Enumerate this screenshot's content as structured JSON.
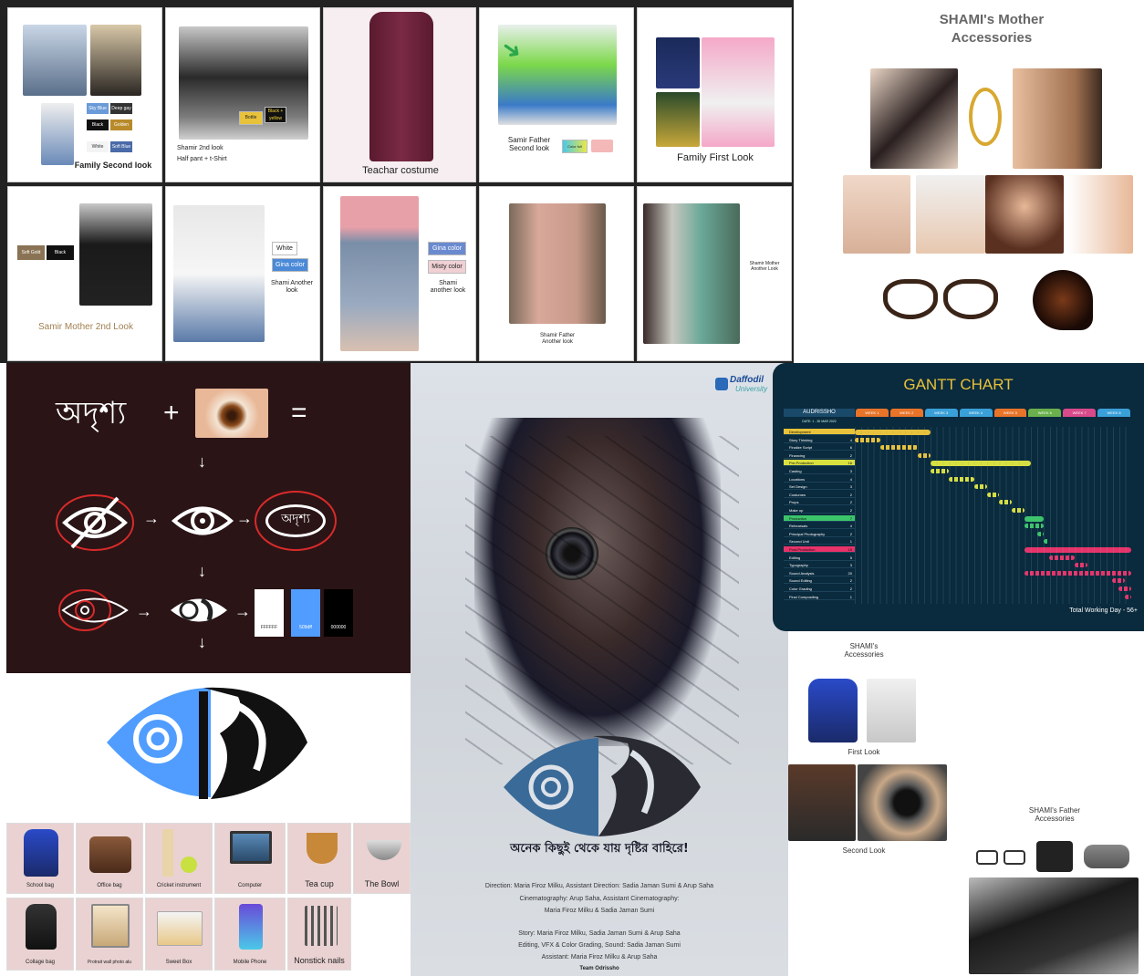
{
  "collage": {
    "costumes": {
      "family_second_look": "Family Second look",
      "swatches_fsl": [
        "Sky Blue",
        "Deep gay",
        "Black",
        "Golden",
        "White",
        "Soft Blue"
      ],
      "shamir_2nd_look": "Shamir 2nd look",
      "half_pant": "Half pant + t-Shirt",
      "tag_bottle": "Bottle",
      "tag_black_yellow": "Black + yellow",
      "teacher_costume": "Teachar costume",
      "samir_father_second_look": "Samir Father\nSecond look",
      "color_full": "Color full",
      "family_first_look": "Family First Look",
      "soft_gold": "Soft Gold",
      "black": "Black",
      "samir_mother_2nd_look": "Samir Mother 2nd Look",
      "white": "White",
      "gina_color": "Gina color",
      "shami_another_look": "Shami Another\nlook",
      "gina_color_2": "Gina color",
      "misty_color": "Misty color",
      "shami_another_look_2": "Shami\nanother look",
      "shamir_father_another_look": "Shamir Father\nAnother look",
      "shamir_mother_another_look": "Shamir Mother\nAnother Look"
    },
    "mother_accessories": {
      "title": "SHAMI's Mother\nAccessories"
    },
    "logo_board": {
      "bangla_word": "অদৃশ্য",
      "plus": "+",
      "equals": "=",
      "arrow_down": "↓",
      "arrow_right": "→",
      "eye_word": "অদৃশ্য",
      "colors": [
        {
          "hex": "#ffffff",
          "label": "FFFFFF"
        },
        {
          "hex": "#509dff",
          "label": "509dff"
        },
        {
          "hex": "#000000",
          "label": "000000"
        }
      ]
    },
    "poster": {
      "university": "Daffodil",
      "university_sub": "University",
      "tagline": "অনেক কিছুই থেকে যায় দৃষ্টির বাহিরে!",
      "credits": [
        "Direction: Maria Firoz Milku, Assistant Direction: Sadia Jaman Sumi & Arup Saha",
        "Cinematography: Arup Saha, Assistant Cinematography:",
        "Maria Firoz Milku & Sadia Jaman Sumi",
        "Story: Maria Firoz Milku, Sadia Jaman Sumi & Arup Saha",
        "Editing, VFX & Color Grading, Sound: Sadia Jaman Sumi",
        "Assistant: Maria Firoz Milku & Arup Saha",
        "Team Odrissho"
      ]
    },
    "gantt": {
      "title": "GANTT CHART",
      "header": "AUDRISSHO",
      "date_range": "DATE: 1 - 30 MAR 2022",
      "weeks": [
        "WEEK 1",
        "WEEK 2",
        "WEEK 3",
        "WEEK 4",
        "WEEK 5",
        "WEEK 6",
        "WEEK 7",
        "WEEK 8"
      ],
      "week_colors": [
        "#e8742a",
        "#e8742a",
        "#3aa0d8",
        "#3aa0d8",
        "#e8742a",
        "#6ab04c",
        "#d84a8a",
        "#3aa0d8"
      ],
      "tasks": [
        {
          "name": "Development",
          "days": "",
          "color": "#e8c23a",
          "start": 0,
          "len": 12,
          "phase": true
        },
        {
          "name": "Story Thinking",
          "days": "4",
          "color": "#e8c23a",
          "start": 0,
          "len": 4
        },
        {
          "name": "Finalize Script",
          "days": "6",
          "color": "#e8c23a",
          "start": 4,
          "len": 6
        },
        {
          "name": "Financing",
          "days": "2",
          "color": "#e8c23a",
          "start": 10,
          "len": 2
        },
        {
          "name": "Pre-Production",
          "days": "16",
          "color": "#d8e040",
          "start": 12,
          "len": 16,
          "phase": true
        },
        {
          "name": "Casting",
          "days": "3",
          "color": "#d8e040",
          "start": 12,
          "len": 3
        },
        {
          "name": "Locations",
          "days": "4",
          "color": "#d8e040",
          "start": 15,
          "len": 4
        },
        {
          "name": "Set Design",
          "days": "3",
          "color": "#d8e040",
          "start": 19,
          "len": 2
        },
        {
          "name": "Costumes",
          "days": "2",
          "color": "#d8e040",
          "start": 21,
          "len": 2
        },
        {
          "name": "Props",
          "days": "2",
          "color": "#d8e040",
          "start": 23,
          "len": 2
        },
        {
          "name": "Make up",
          "days": "2",
          "color": "#d8e040",
          "start": 25,
          "len": 2
        },
        {
          "name": "Production",
          "days": "7",
          "color": "#3cc46a",
          "start": 27,
          "len": 3,
          "phase": true
        },
        {
          "name": "Rehearsals",
          "days": "4",
          "color": "#3cc46a",
          "start": 27,
          "len": 3
        },
        {
          "name": "Principal Photography",
          "days": "2",
          "color": "#3cc46a",
          "start": 29,
          "len": 1
        },
        {
          "name": "Second Unit",
          "days": "1",
          "color": "#3cc46a",
          "start": 30,
          "len": 1
        },
        {
          "name": "Post-Production",
          "days": "15",
          "color": "#e8336a",
          "start": 27,
          "len": 17,
          "phase": true
        },
        {
          "name": "Editing",
          "days": "5",
          "color": "#e8336a",
          "start": 31,
          "len": 4
        },
        {
          "name": "Typography",
          "days": "3",
          "color": "#e8336a",
          "start": 35,
          "len": 2
        },
        {
          "name": "Sound Analysis",
          "days": "20",
          "color": "#e8336a",
          "start": 27,
          "len": 17
        },
        {
          "name": "Sound Editing",
          "days": "2",
          "color": "#e8336a",
          "start": 41,
          "len": 2
        },
        {
          "name": "Color Grading",
          "days": "2",
          "color": "#e8336a",
          "start": 42,
          "len": 2
        },
        {
          "name": "Final Compositing",
          "days": "1",
          "color": "#e8336a",
          "start": 43,
          "len": 1
        }
      ],
      "total": "Total Working Day - 56+"
    },
    "shami_accessories": {
      "title": "SHAMI's\nAccessories",
      "first_look": "First Look",
      "second_look": "Second Look"
    },
    "father_accessories": {
      "title": "SHAMI's Father\nAccessories"
    },
    "props": [
      {
        "label": "School bag",
        "icon": "school-bag-icon"
      },
      {
        "label": "Office bag",
        "icon": "office-bag-icon"
      },
      {
        "label": "Cricket instrument",
        "icon": "cricket-icon"
      },
      {
        "label": "Computer",
        "icon": "computer-icon"
      },
      {
        "label": "Tea cup",
        "icon": "tea-cup-icon"
      },
      {
        "label": "The Bowl",
        "icon": "bowl-icon"
      },
      {
        "label": "Collage bag",
        "icon": "backpack-icon"
      },
      {
        "label": "Protrait wall photo alu",
        "icon": "photo-wall-icon"
      },
      {
        "label": "Sweet Box",
        "icon": "sweet-box-icon"
      },
      {
        "label": "Mobile Phone",
        "icon": "phone-icon"
      },
      {
        "label": "Nonstick nails",
        "icon": "utensils-icon"
      }
    ]
  }
}
